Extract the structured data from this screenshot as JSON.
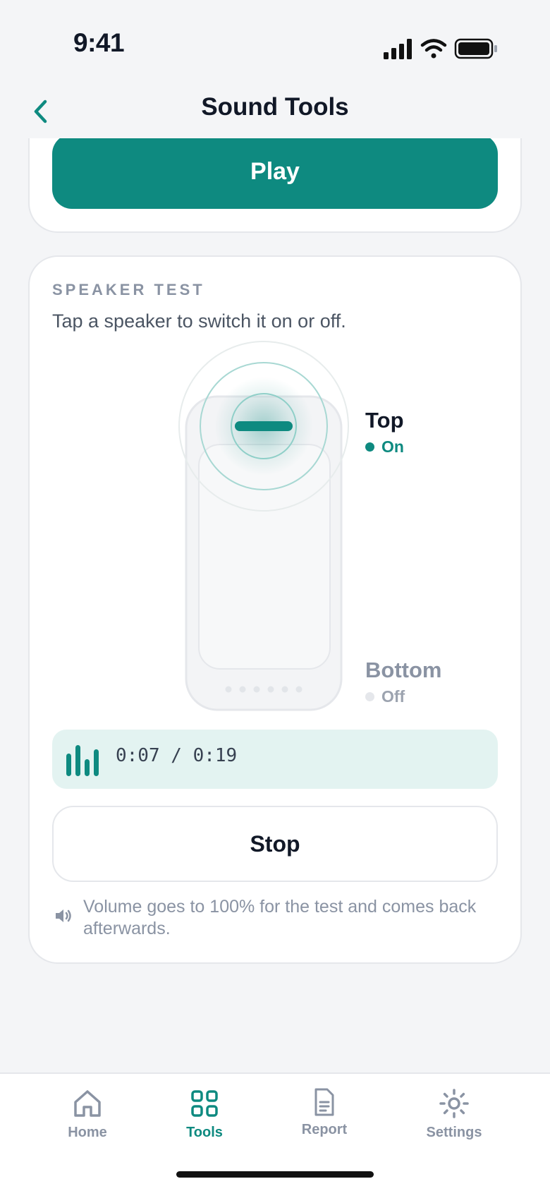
{
  "status_bar": {
    "time": "9:41"
  },
  "header": {
    "title": "Sound Tools"
  },
  "top_card": {
    "play_label": "Play"
  },
  "speaker_test": {
    "section_label": "SPEAKER TEST",
    "description": "Tap a speaker to switch it on or off.",
    "speakers": [
      {
        "name": "Top",
        "status": "On",
        "active": true
      },
      {
        "name": "Bottom",
        "status": "Off",
        "active": false
      }
    ],
    "playback": {
      "elapsed_total": "0:07 / 0:19"
    },
    "stop_label": "Stop",
    "note": "Volume goes to 100% for the test and comes back afterwards."
  },
  "tab_bar": {
    "items": [
      {
        "label": "Home",
        "icon": "home-icon",
        "active": false
      },
      {
        "label": "Tools",
        "icon": "grid-icon",
        "active": true
      },
      {
        "label": "Report",
        "icon": "document-icon",
        "active": false
      },
      {
        "label": "Settings",
        "icon": "gear-icon",
        "active": false
      }
    ]
  },
  "colors": {
    "accent": "#0E8A80",
    "background": "#F4F5F7",
    "muted": "#8A93A3"
  }
}
